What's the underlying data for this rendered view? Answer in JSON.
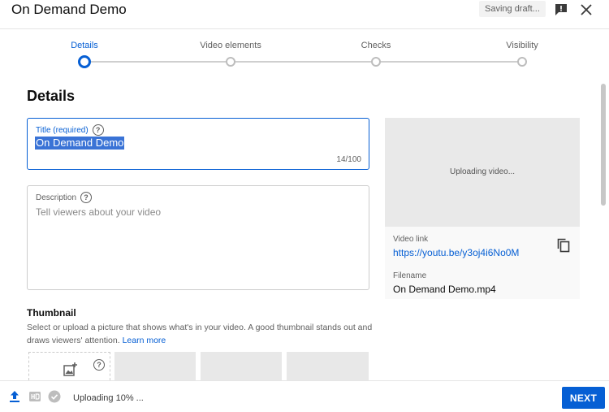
{
  "header": {
    "title": "On Demand Demo",
    "status": "Saving draft..."
  },
  "steps": [
    {
      "label": "Details",
      "active": true
    },
    {
      "label": "Video elements",
      "active": false
    },
    {
      "label": "Checks",
      "active": false
    },
    {
      "label": "Visibility",
      "active": false
    }
  ],
  "details": {
    "heading": "Details",
    "title_field": {
      "label": "Title (required)",
      "value": "On Demand Demo",
      "counter": "14/100"
    },
    "description_field": {
      "label": "Description",
      "placeholder": "Tell viewers about your video"
    },
    "help_glyph": "?"
  },
  "thumbnail": {
    "heading": "Thumbnail",
    "description": "Select or upload a picture that shows what's in your video. A good thumbnail stands out and draws viewers' attention.",
    "learn_more": "Learn more"
  },
  "preview": {
    "status": "Uploading video...",
    "video_link_label": "Video link",
    "video_link": "https://youtu.be/y3oj4i6No0M",
    "filename_label": "Filename",
    "filename": "On Demand Demo.mp4"
  },
  "footer": {
    "upload_status": "Uploading 10% ...",
    "next_label": "NEXT"
  },
  "colors": {
    "accent": "#065fd4",
    "selection": "#3a73d6"
  },
  "icons": [
    "feedback-icon",
    "close-icon",
    "help-icon",
    "add-image-icon",
    "copy-icon",
    "upload-icon",
    "hd-icon",
    "check-circle-icon"
  ]
}
